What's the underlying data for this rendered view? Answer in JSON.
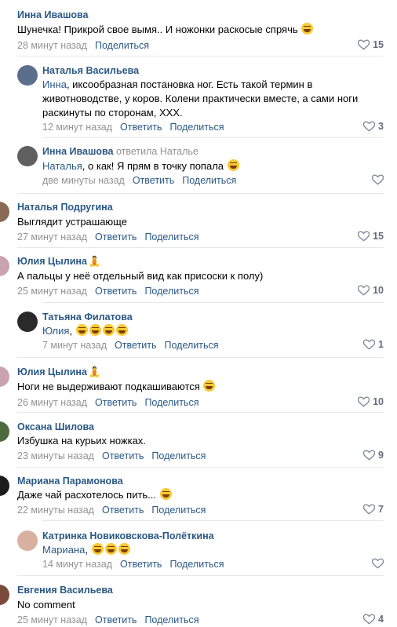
{
  "labels": {
    "reply": "Ответить",
    "share": "Поделиться"
  },
  "comments": [
    {
      "name": "Инна Ивашова",
      "text": "Шунечка! Прикрой свое вымя.. И ножонки раскосые спрячь",
      "emoji": [
        "laugh"
      ],
      "time": "28 минут назад",
      "has_reply": false,
      "likes": "15"
    },
    {
      "name": "Наталья Васильева",
      "mention": "Инна",
      "text": ", иксообразная постановка ног. Есть такой термин в животноводстве, у коров. Колени практически вместе, а сами ноги раскинуты по сторонам, XXX.",
      "time": "12 минут назад",
      "has_reply": true,
      "likes": "3"
    },
    {
      "name": "Инна Ивашова",
      "reply_to": "ответила Наталье",
      "mention": "Наталья",
      "text": ", о как! Я прям в точку попала",
      "emoji": [
        "laugh"
      ],
      "time": "две минуты назад",
      "has_reply": true,
      "likes": ""
    },
    {
      "name": "Наталья Подругина",
      "text": "Выглядит устрашающе",
      "time": "27 минут назад",
      "has_reply": true,
      "likes": "15"
    },
    {
      "name": "Юлия Цылина",
      "tag": "🧘",
      "text": "А пальцы у неё отдельный вид как присоски к полу)",
      "time": "25 минут назад",
      "has_reply": true,
      "likes": "10"
    },
    {
      "name": "Татьяна Филатова",
      "mention": "Юлия",
      "text": ",",
      "emoji": [
        "laugh",
        "laugh",
        "laugh",
        "laugh"
      ],
      "time": "7 минут назад",
      "has_reply": true,
      "likes": "1"
    },
    {
      "name": "Юлия Цылина",
      "tag": "🧘",
      "text": "Ноги не выдерживают подкашиваются",
      "emoji": [
        "laugh"
      ],
      "time": "26 минут назад",
      "has_reply": true,
      "likes": "10"
    },
    {
      "name": "Оксана Шилова",
      "text": "Избушка на курьих ножках.",
      "time": "23 минуты назад",
      "has_reply": true,
      "likes": "9"
    },
    {
      "name": "Мариана Парамонова",
      "text": "Даже чай расхотелось пить...",
      "emoji": [
        "laugh"
      ],
      "time": "22 минуты назад",
      "has_reply": true,
      "likes": "7"
    },
    {
      "name": "Катринка Новиковскова-Полёткина",
      "mention": "Мариана",
      "text": ",",
      "emoji": [
        "laugh",
        "laugh",
        "laugh"
      ],
      "time": "14 минут назад",
      "has_reply": true,
      "likes": ""
    },
    {
      "name": "Евгения Васильева",
      "text": "No comment",
      "time": "25 минут назад",
      "has_reply": true,
      "likes": "4"
    }
  ]
}
